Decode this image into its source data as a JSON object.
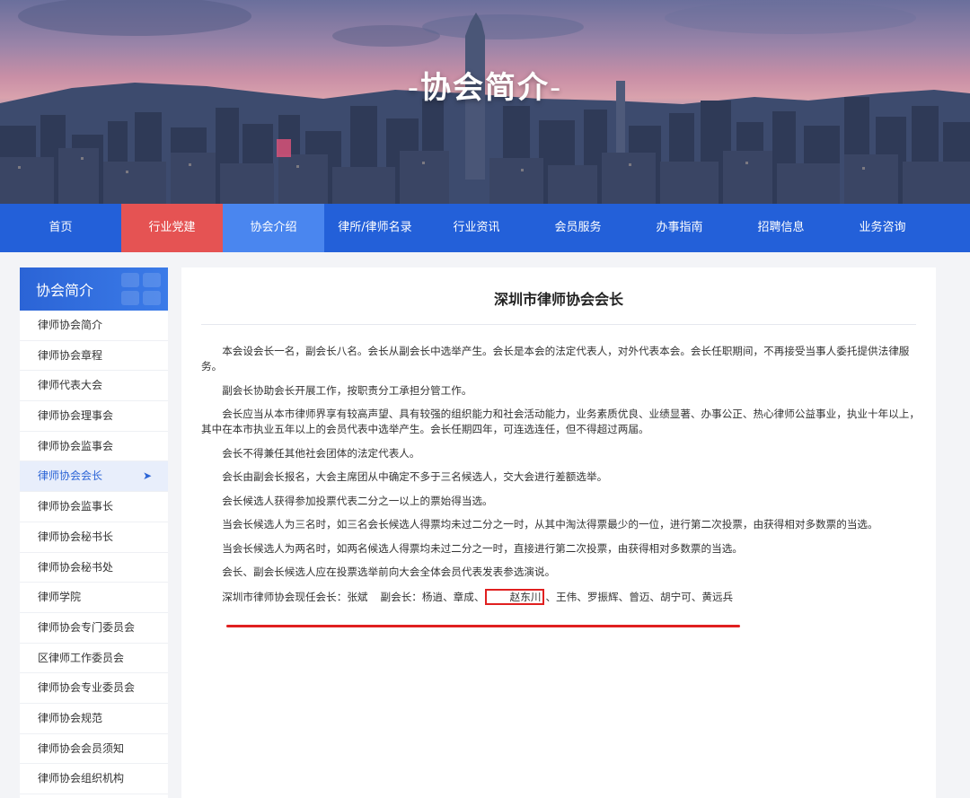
{
  "banner": {
    "title": "协会简介",
    "dash_left": "-",
    "dash_right": "-"
  },
  "nav": {
    "items": [
      {
        "label": "首页"
      },
      {
        "label": "行业党建"
      },
      {
        "label": "协会介绍"
      },
      {
        "label": "律所/律师名录"
      },
      {
        "label": "行业资讯"
      },
      {
        "label": "会员服务"
      },
      {
        "label": "办事指南"
      },
      {
        "label": "招聘信息"
      },
      {
        "label": "业务咨询"
      }
    ],
    "active_index": 2,
    "highlight_color": "#e55353",
    "bar_color": "#2360d9"
  },
  "sidebar": {
    "title": "协会简介",
    "items": [
      {
        "label": "律师协会简介"
      },
      {
        "label": "律师协会章程"
      },
      {
        "label": "律师代表大会"
      },
      {
        "label": "律师协会理事会"
      },
      {
        "label": "律师协会监事会"
      },
      {
        "label": "律师协会会长"
      },
      {
        "label": "律师协会监事长"
      },
      {
        "label": "律师协会秘书长"
      },
      {
        "label": "律师协会秘书处"
      },
      {
        "label": "律师学院"
      },
      {
        "label": "律师协会专门委员会"
      },
      {
        "label": "区律师工作委员会"
      },
      {
        "label": "律师协会专业委员会"
      },
      {
        "label": "律师协会规范"
      },
      {
        "label": "律师协会会员须知"
      },
      {
        "label": "律师协会组织机构"
      }
    ],
    "active_index": 5,
    "active_arrow": "➤"
  },
  "article": {
    "title": "深圳市律师协会会长",
    "paragraphs": [
      "本会设会长一名，副会长八名。会长从副会长中选举产生。会长是本会的法定代表人，对外代表本会。会长任职期间，不再接受当事人委托提供法律服务。",
      "副会长协助会长开展工作，按职责分工承担分管工作。",
      "会长应当从本市律师界享有较高声望、具有较强的组织能力和社会活动能力，业务素质优良、业绩显著、办事公正、热心律师公益事业，执业十年以上，其中在本市执业五年以上的会员代表中选举产生。会长任期四年，可连选连任，但不得超过两届。",
      "会长不得兼任其他社会团体的法定代表人。",
      "会长由副会长报名，大会主席团从中确定不多于三名候选人，交大会进行差额选举。",
      "会长候选人获得参加投票代表二分之一以上的票始得当选。",
      "当会长候选人为三名时，如三名会长候选人得票均未过二分之一时，从其中淘汰得票最少的一位，进行第二次投票，由获得相对多数票的当选。",
      "当会长候选人为两名时，如两名候选人得票均未过二分之一时，直接进行第二次投票，由获得相对多数票的当选。",
      "会长、副会长候选人应在投票选举前向大会全体会员代表发表参选演说。"
    ],
    "members": {
      "president_label": "深圳市律师协会现任会长：张斌",
      "vp_label_before": "副会长：杨逍、章成、",
      "vp_highlighted": "赵东川",
      "vp_label_after": "、王伟、罗振辉、曾迈、胡宁可、黄远兵"
    },
    "annotation_color": "#e02020"
  }
}
